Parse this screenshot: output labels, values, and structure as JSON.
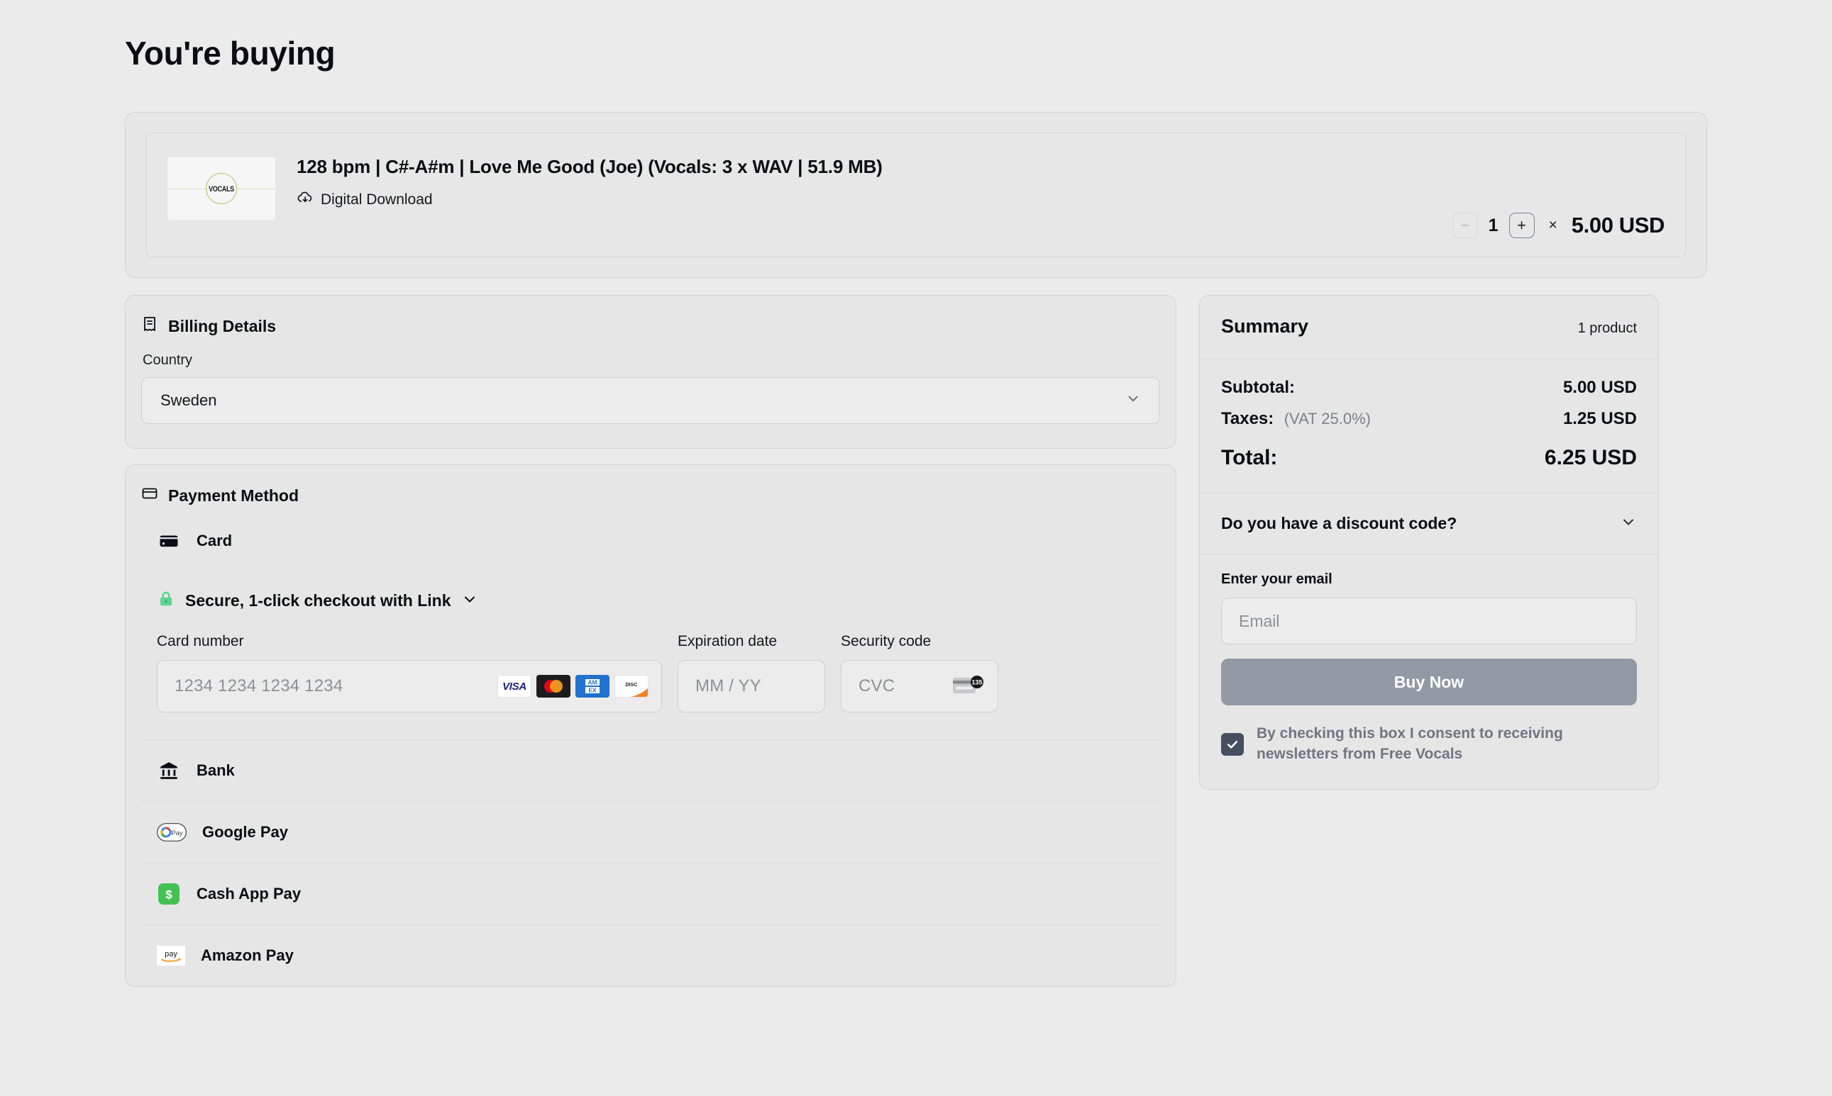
{
  "page": {
    "title": "You're buying",
    "background_color": "#ebebeb"
  },
  "product": {
    "title": "128 bpm | C#-A#m | Love Me Good (Joe) (Vocals: 3 x WAV | 51.9 MB)",
    "delivery_label": "Digital Download",
    "delivery_icon": "cloud-download-icon",
    "thumbnail_text": "VOCALS",
    "thumbnail_accent": "#aac45f",
    "quantity": "1",
    "decrease_label": "−",
    "increase_label": "+",
    "multiply_symbol": "×",
    "unit_price": "5.00 USD"
  },
  "billing": {
    "section_title": "Billing Details",
    "section_icon": "receipt-icon",
    "country_label": "Country",
    "country_value": "Sweden",
    "chevron_icon": "chevron-down-icon"
  },
  "payment": {
    "section_title": "Payment Method",
    "section_icon": "credit-card-icon",
    "methods": [
      {
        "id": "card",
        "label": "Card",
        "icon": "card-icon",
        "selected": true
      },
      {
        "id": "bank",
        "label": "Bank",
        "icon": "bank-icon",
        "selected": false
      },
      {
        "id": "google-pay",
        "label": "Google Pay",
        "icon": "google-pay-icon",
        "selected": false
      },
      {
        "id": "cash-app-pay",
        "label": "Cash App Pay",
        "icon": "cash-app-icon",
        "selected": false
      },
      {
        "id": "amazon-pay",
        "label": "Amazon Pay",
        "icon": "amazon-pay-icon",
        "selected": false
      }
    ],
    "link": {
      "text": "Secure, 1-click checkout with Link",
      "lock_icon": "lock-icon",
      "lock_color": "#5ed492",
      "chevron_icon": "chevron-down-icon"
    },
    "card_form": {
      "number_label": "Card number",
      "number_placeholder": "1234 1234 1234 1234",
      "expiry_label": "Expiration date",
      "expiry_placeholder": "MM / YY",
      "cvc_label": "Security code",
      "cvc_placeholder": "CVC",
      "cvc_icon": "cvc-card-icon",
      "cvc_icon_number": "135",
      "brands": [
        "VISA",
        "Mastercard",
        "AMEX",
        "DISCOVER"
      ]
    }
  },
  "summary": {
    "title": "Summary",
    "product_count": "1 product",
    "subtotal_label": "Subtotal:",
    "subtotal_value": "5.00 USD",
    "taxes_label": "Taxes:",
    "taxes_note": "(VAT 25.0%)",
    "taxes_value": "1.25 USD",
    "total_label": "Total:",
    "total_value": "6.25 USD",
    "discount_label": "Do you have a discount code?",
    "discount_chevron": "chevron-down-icon",
    "email_label": "Enter your email",
    "email_placeholder": "Email",
    "email_value": "",
    "buy_label": "Buy Now",
    "buy_color": "#9299a5",
    "consent_text": "By checking this box I consent to receiving newsletters from Free Vocals",
    "consent_checked": true,
    "consent_color": "#464f60"
  }
}
